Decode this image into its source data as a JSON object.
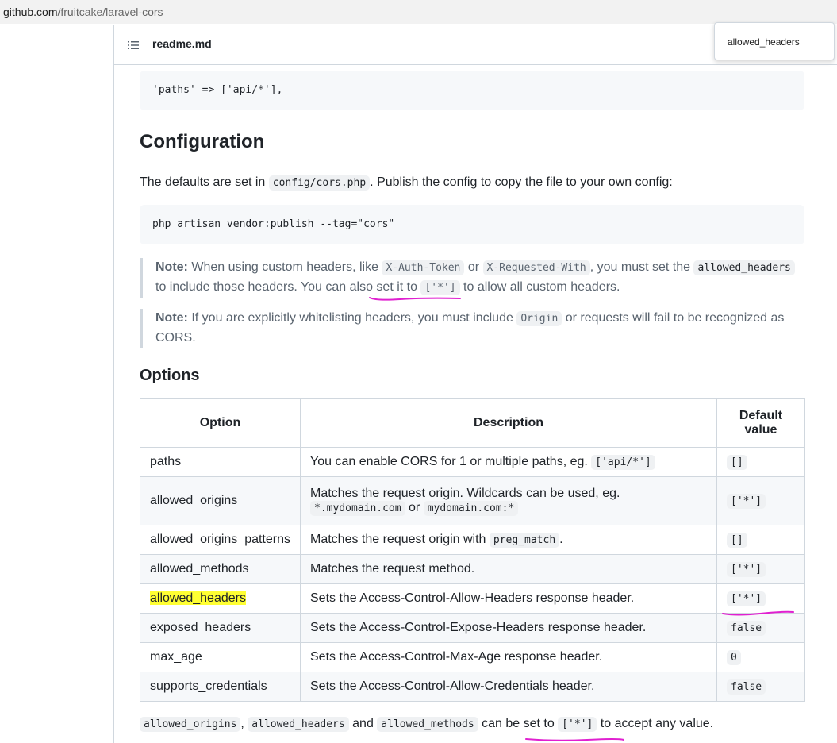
{
  "browser": {
    "url_domain": "github.com",
    "url_path": "/fruitcake/laravel-cors"
  },
  "readme": {
    "filename": "readme.md",
    "list_icon": "list-icon"
  },
  "find_popup": {
    "text": "allowed_headers"
  },
  "content": {
    "code_paths": "'paths' => ['api/*'],",
    "heading_config": "Configuration",
    "defaults_pre": "The defaults are set in ",
    "defaults_code": "config/cors.php",
    "defaults_post": ". Publish the config to copy the file to your own config:",
    "code_publish": "php artisan vendor:publish --tag=\"cors\"",
    "note1": {
      "label": "Note:",
      "t1": " When using custom headers, like ",
      "c1": "X-Auth-Token",
      "t2": " or ",
      "c2": "X-Requested-With",
      "t3": ", you must set the ",
      "c3": "allowed_headers",
      "t4": "to include those headers. You can also set it to ",
      "c4": "['*']",
      "t5": " to allow all custom headers."
    },
    "note2": {
      "label": "Note:",
      "t1": " If you are explicitly whitelisting headers, you must include ",
      "c1": "Origin",
      "t2": " or requests will fail to be recognized as",
      "t3": "CORS."
    },
    "heading_options": "Options",
    "table": {
      "headers": [
        "Option",
        "Description",
        "Default",
        "value"
      ],
      "rows": [
        {
          "option": "paths",
          "desc": "You can enable CORS for 1 or multiple paths, eg. ",
          "desc_code": "['api/*']",
          "default": "[]"
        },
        {
          "option": "allowed_origins",
          "desc": "Matches the request origin. Wildcards can be used, eg.",
          "desc_code": "*.mydomain.com",
          "desc_mid": " or ",
          "desc_code2": "mydomain.com:*",
          "default": "['*']"
        },
        {
          "option": "allowed_origins_patterns",
          "desc": "Matches the request origin with ",
          "desc_code": "preg_match",
          "desc_post": ".",
          "default": "[]"
        },
        {
          "option": "allowed_methods",
          "desc": "Matches the request method.",
          "default": "['*']"
        },
        {
          "option": "allowed_headers",
          "desc": "Sets the Access-Control-Allow-Headers response header.",
          "default": "['*']"
        },
        {
          "option": "exposed_headers",
          "desc": "Sets the Access-Control-Expose-Headers response header.",
          "default": "false"
        },
        {
          "option": "max_age",
          "desc": "Sets the Access-Control-Max-Age response header.",
          "default": "0"
        },
        {
          "option": "supports_credentials",
          "desc": "Sets the Access-Control-Allow-Credentials header.",
          "default": "false"
        }
      ]
    },
    "bottom": {
      "c1": "allowed_origins",
      "t1": ", ",
      "c2": "allowed_headers",
      "t2": " and ",
      "c3": "allowed_methods",
      "t3": " can be set to ",
      "c4": "['*']",
      "t4": " to accept any value."
    }
  },
  "colors": {
    "highlight_orange": "#f68f3c",
    "highlight_yellow": "#ffff33",
    "annotation_pink": "#e020d0"
  }
}
